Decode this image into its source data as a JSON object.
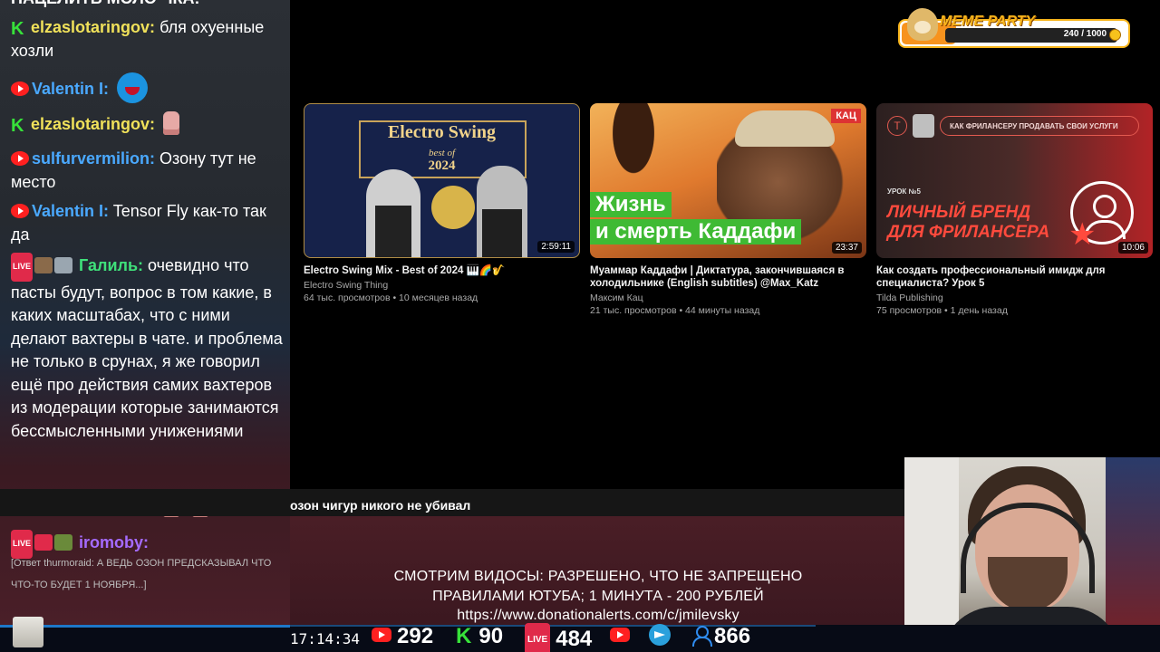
{
  "chat": {
    "top_cut": "НАЦЕЛИТЬ МОЛО ЧКА!",
    "messages": [
      {
        "platform": "kick",
        "user": "elzaslotaringov",
        "user_color": "#f0e15a",
        "text": "бля охуенные хозли"
      },
      {
        "platform": "youtube",
        "user": "Valentin I",
        "user_color": "#4aa9ff",
        "emote": "blue-monster-emote"
      },
      {
        "platform": "kick",
        "user": "elzaslotaringov",
        "user_color": "#f0e15a",
        "emote": "pink-pig-emote"
      },
      {
        "platform": "youtube",
        "user": "sulfurvermilion",
        "user_color": "#4aa9ff",
        "text": "Озону тут не место"
      },
      {
        "platform": "youtube",
        "user": "Valentin I",
        "user_color": "#4aa9ff",
        "text": "Tensor Fly как-то так да"
      },
      {
        "platform": "vk",
        "user": "Галиль",
        "user_color": "#3fe07a",
        "text": "очевидно что пасты будут, вопрос в том какие, в каких масштабах, что с ними делают вахтеры в чате. и проблема не только в срунах, я же говорил ещё про действия самих вахтеров из модерации которые занимаются бессмысленными унижениями"
      },
      {
        "platform": "kick",
        "user": "elzaslotaringov",
        "user_color": "#f0e15a",
        "emote": "pink-pig-emote-x2"
      },
      {
        "platform": "vk",
        "user": "iromoby",
        "user_color": "#a56bff",
        "reply": "[Ответ thurmoraid: А ВЕДЬ ОЗОН ПРЕДСКАЗЫВАЛ ЧТО ЧТО-ТО БУДЕТ 1 НОЯБРЯ...]"
      }
    ]
  },
  "videos": [
    {
      "title": "Electro Swing Mix - Best of 2024 🎹🌈🎷",
      "channel": "Electro Swing Thing",
      "meta": "64 тыс. просмотров • 10 месяцев назад",
      "duration": "2:59:11",
      "thumb_text": {
        "title": "Electro Swing",
        "sub": "best of",
        "year": "2024"
      }
    },
    {
      "title": "Муаммар Каддафи | Диктатура, закончившаяся в холодильнике (English subtitles) @Max_Katz",
      "channel": "Максим Кац",
      "meta": "21 тыс. просмотров • 44 минуты назад",
      "duration": "23:37",
      "thumb_text": {
        "tag": "КАЦ",
        "line1": "Жизнь",
        "line2": "и смерть Каддафи"
      }
    },
    {
      "title": "Как создать профессиональный имидж для специалиста? Урок 5",
      "channel": "Tilda Publishing",
      "meta": "75 просмотров • 1 день назад",
      "duration": "10:06",
      "thumb_text": {
        "pill": "КАК ФРИЛАНСЕРУ ПРОДАВАТЬ СВОИ УСЛУГИ",
        "lesson": "УРОК №5",
        "big1": "ЛИЧНЫЙ БРЕНД",
        "big2": "ДЛЯ ФРИЛАНСЕРА",
        "logo": "T"
      }
    }
  ],
  "strip_text": "озон чигур никого не убивал",
  "announcement": {
    "line1": "СМОТРИМ ВИДОСЫ: РАЗРЕШЕНО, ЧТО НЕ ЗАПРЕЩЕНО",
    "line2": "ПРАВИЛАМИ ЮТУБА; 1 МИНУТА - 200 РУБЛЕЙ",
    "line3": "https://www.donationalerts.com/c/jmilevsky"
  },
  "bottom_bar": {
    "clock": "17:14:34",
    "youtube_viewers": "292",
    "kick_viewers": "90",
    "vk_viewers": "484",
    "total_viewers": "866",
    "kick_label": "K",
    "live_label": "LIVE"
  },
  "meme_party": {
    "title": "MEME PARTY",
    "progress": "240 / 1000",
    "progress_fraction": 0.24
  },
  "colors": {
    "youtube_red": "#ff2020",
    "kick_green": "#37e13a",
    "vk_live_red": "#e02a4a",
    "telegram_blue": "#2aa0dc",
    "meme_orange": "#f7b51c"
  }
}
